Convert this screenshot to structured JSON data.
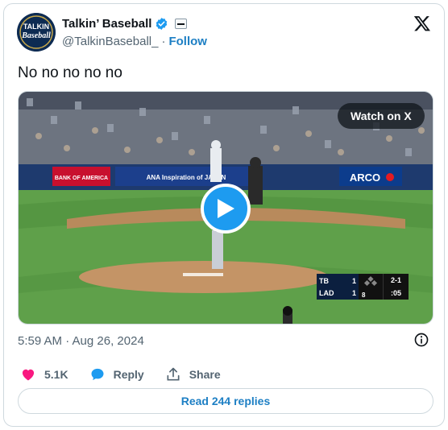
{
  "author": {
    "display_name": "Talkin’ Baseball",
    "handle": "@TalkinBaseball_",
    "separator": "·",
    "follow_label": "Follow",
    "avatar_line1": "TALKIN",
    "avatar_line2": "Baseball"
  },
  "tweet": {
    "text": "No no no no no",
    "timestamp": "5:59 AM · Aug 26, 2024"
  },
  "media": {
    "watch_label": "Watch on X",
    "banner_left": "BANK OF AMERICA",
    "banner_mid": "ANA Inspiration of JAPAN",
    "banner_right": "ARCO",
    "scorebug": {
      "away_team": "TB",
      "away_score": "1",
      "home_team": "LAD",
      "home_score": "1",
      "inning": "8",
      "count": "2-1",
      "clock": ":05"
    }
  },
  "actions": {
    "likes": "5.1K",
    "reply_label": "Reply",
    "share_label": "Share"
  },
  "replies_button": "Read 244 replies",
  "colors": {
    "accent": "#1d9bf0",
    "like": "#f91880",
    "link": "#1d7fc4"
  },
  "icons": [
    "verified-icon",
    "x-logo-icon",
    "play-icon",
    "info-icon",
    "heart-icon",
    "reply-icon",
    "share-icon"
  ]
}
